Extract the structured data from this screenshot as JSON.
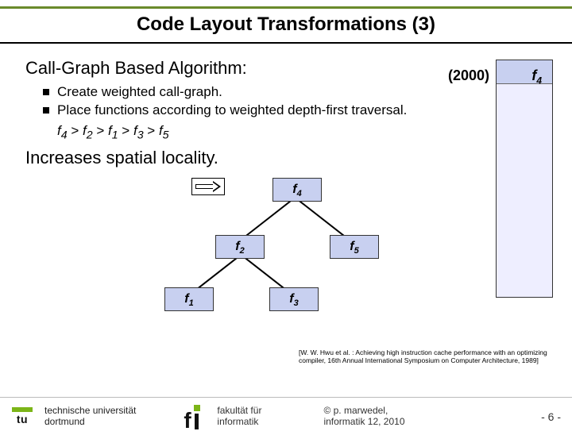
{
  "title": "Code Layout Transformations (3)",
  "heading": "Call-Graph Based Algorithm:",
  "bullets": {
    "b1": "Create weighted call-graph.",
    "b2": "Place functions according to weighted depth-first traversal."
  },
  "order": {
    "f4": "f",
    "s4": "4",
    "gt1": " > ",
    "f2": "f",
    "s2": "2",
    "gt2": " > ",
    "f1": "f",
    "s1": "1",
    "gt3": " > ",
    "f3": "f",
    "s3": "3",
    "gt4": " > ",
    "f5": "f",
    "s5": "5"
  },
  "heading2": "Increases spatial locality.",
  "year": "(2000)",
  "memlabel": {
    "f": "f",
    "s": "4"
  },
  "tree": {
    "f4": {
      "f": "f",
      "s": "4"
    },
    "f2": {
      "f": "f",
      "s": "2"
    },
    "f5": {
      "f": "f",
      "s": "5"
    },
    "f1": {
      "f": "f",
      "s": "1"
    },
    "f3": {
      "f": "f",
      "s": "3"
    }
  },
  "citation": "[W. W. Hwu et al. : Achieving high instruction cache performance with an optimizing compiler, 16th Annual International Symposium on Computer Architecture, 1989]",
  "footer": {
    "tu": "tu",
    "uni1": "technische universität",
    "uni2": "dortmund",
    "fak1": "fakultät für",
    "fak2": "informatik",
    "cred1": "© p. marwedel,",
    "cred2": "informatik 12,  2010",
    "page": "-  6 -"
  }
}
